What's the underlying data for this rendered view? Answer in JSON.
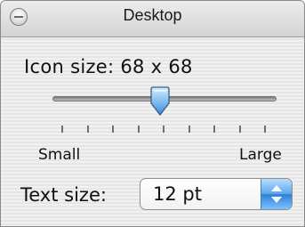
{
  "window": {
    "title": "Desktop"
  },
  "icon_size": {
    "label": "Icon size: 68 x 68",
    "slider_fraction": 0.48
  },
  "slider": {
    "min_label": "Small",
    "max_label": "Large",
    "tick_count": 9
  },
  "text_size": {
    "label": "Text size:",
    "selected_value": "12 pt"
  },
  "colors": {
    "accent": "#4a9be8",
    "thumb_fill": "#8ec3f3"
  },
  "icons": {
    "close": "minus-circle-icon",
    "thumb": "slider-thumb",
    "popup": "up-down-arrows-icon"
  }
}
